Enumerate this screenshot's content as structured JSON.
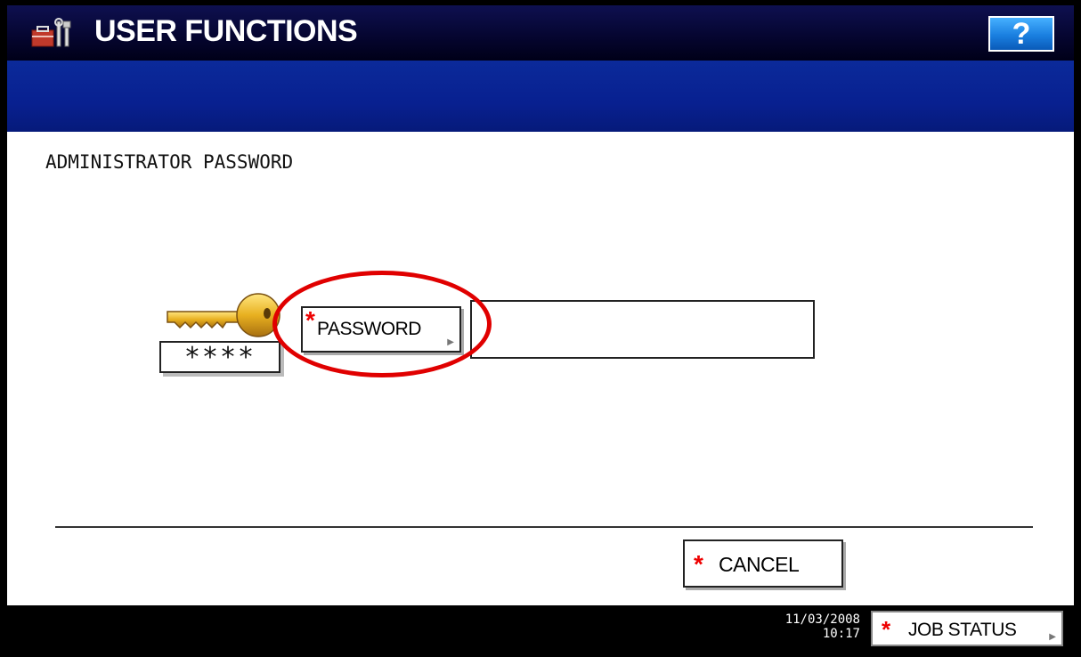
{
  "header": {
    "title": "USER FUNCTIONS",
    "title_icon": "toolbox-icon",
    "help_label": "?"
  },
  "main": {
    "section_title": "ADMINISTRATOR PASSWORD",
    "masked_display": "****",
    "password_button_label": "PASSWORD",
    "password_value": "",
    "key_icon": "key-icon"
  },
  "footer": {
    "cancel_label": "CANCEL"
  },
  "statusbar": {
    "date": "11/03/2008",
    "time": "10:17",
    "job_status_label": "JOB STATUS"
  },
  "colors": {
    "title_bg": "#05052e",
    "blue_band": "#082090",
    "accent_red": "#e00000",
    "help_blue": "#1a7fe0"
  }
}
